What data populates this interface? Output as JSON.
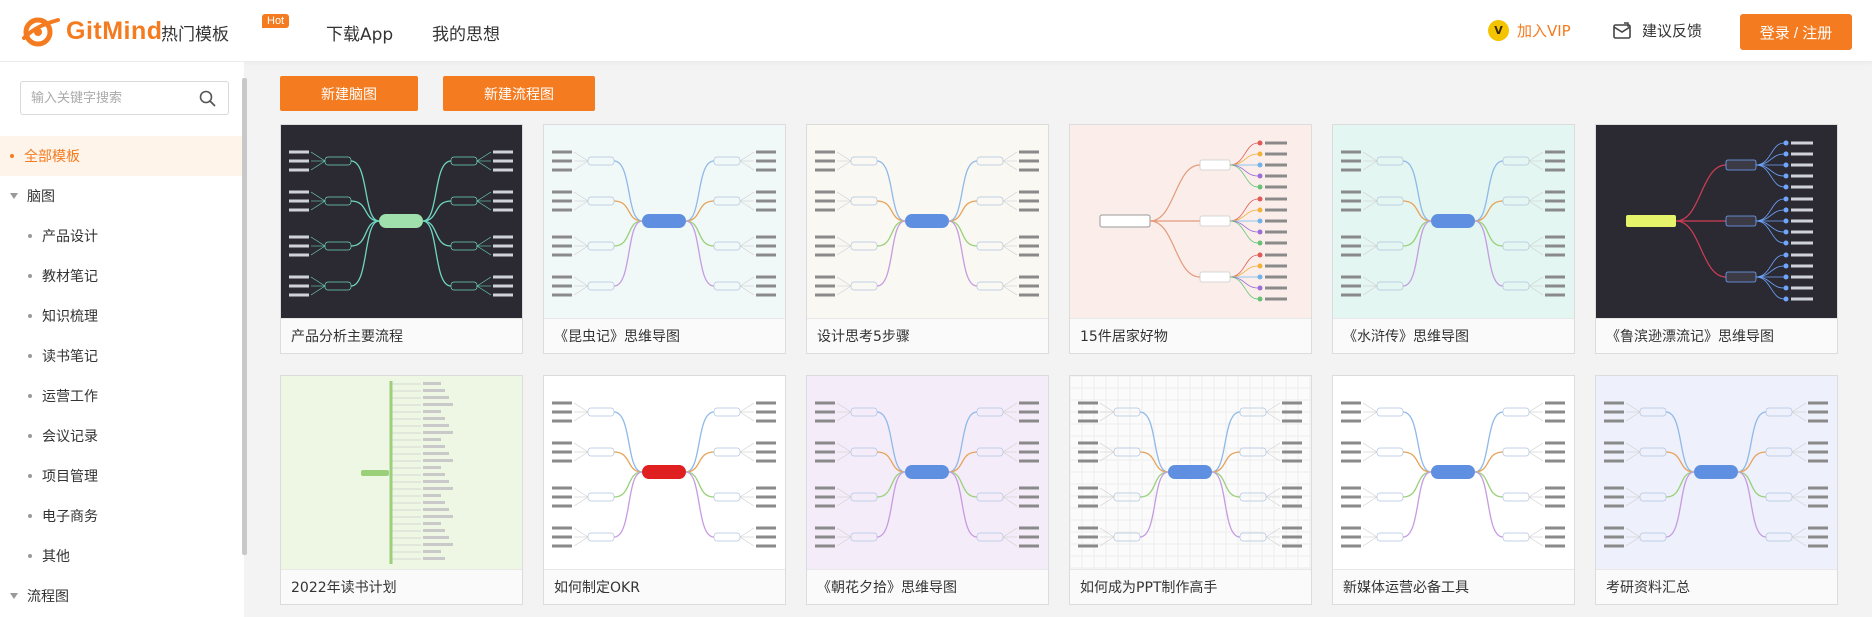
{
  "header": {
    "logo_text": "GitMind",
    "nav": [
      "热门模板",
      "下载App",
      "我的思想"
    ],
    "hot_badge": "Hot",
    "vip_label": "加入VIP",
    "feedback_label": "建议反馈",
    "login_label": "登录 / 注册"
  },
  "sidebar": {
    "search_placeholder": "输入关键字搜索",
    "categories": [
      {
        "label": "全部模板",
        "level": 0,
        "active": true
      },
      {
        "label": "脑图",
        "level": 0,
        "group": true
      },
      {
        "label": "产品设计",
        "level": 1
      },
      {
        "label": "教材笔记",
        "level": 1
      },
      {
        "label": "知识梳理",
        "level": 1
      },
      {
        "label": "读书笔记",
        "level": 1
      },
      {
        "label": "运营工作",
        "level": 1
      },
      {
        "label": "会议记录",
        "level": 1
      },
      {
        "label": "项目管理",
        "level": 1
      },
      {
        "label": "电子商务",
        "level": 1
      },
      {
        "label": "其他",
        "level": 1
      },
      {
        "label": "流程图",
        "level": 0,
        "group": true
      }
    ]
  },
  "actions": {
    "new_mindmap": "新建脑图",
    "new_flowchart": "新建流程图"
  },
  "templates": [
    {
      "title": "产品分析主要流程",
      "bg": "#2b2a33",
      "style": "dark-mindmap"
    },
    {
      "title": "《昆虫记》思维导图",
      "bg": "#f1f9f8",
      "style": "light-mindmap"
    },
    {
      "title": "设计思考5步骤",
      "bg": "#faf8f3",
      "style": "light-mindmap"
    },
    {
      "title": "15件居家好物",
      "bg": "#fbeeea",
      "style": "right-tree"
    },
    {
      "title": "《水浒传》思维导图",
      "bg": "#e3f6f1",
      "style": "light-mindmap"
    },
    {
      "title": "《鲁滨逊漂流记》思维导图",
      "bg": "#2b2a33",
      "style": "dark-tree"
    },
    {
      "title": "2022年读书计划",
      "bg": "#eef6e4",
      "style": "vertical-list"
    },
    {
      "title": "如何制定OKR",
      "bg": "#ffffff",
      "style": "light-mindmap"
    },
    {
      "title": "《朝花夕拾》思维导图",
      "bg": "#f5ecf9",
      "style": "light-mindmap"
    },
    {
      "title": "如何成为PPT制作高手",
      "bg": "#fbfbfb",
      "style": "grid-tree"
    },
    {
      "title": "新媒体运营必备工具",
      "bg": "#ffffff",
      "style": "light-mindmap"
    },
    {
      "title": "考研资料汇总",
      "bg": "#eef0fb",
      "style": "light-mindmap"
    }
  ],
  "colors": {
    "accent": "#f47b1f"
  }
}
